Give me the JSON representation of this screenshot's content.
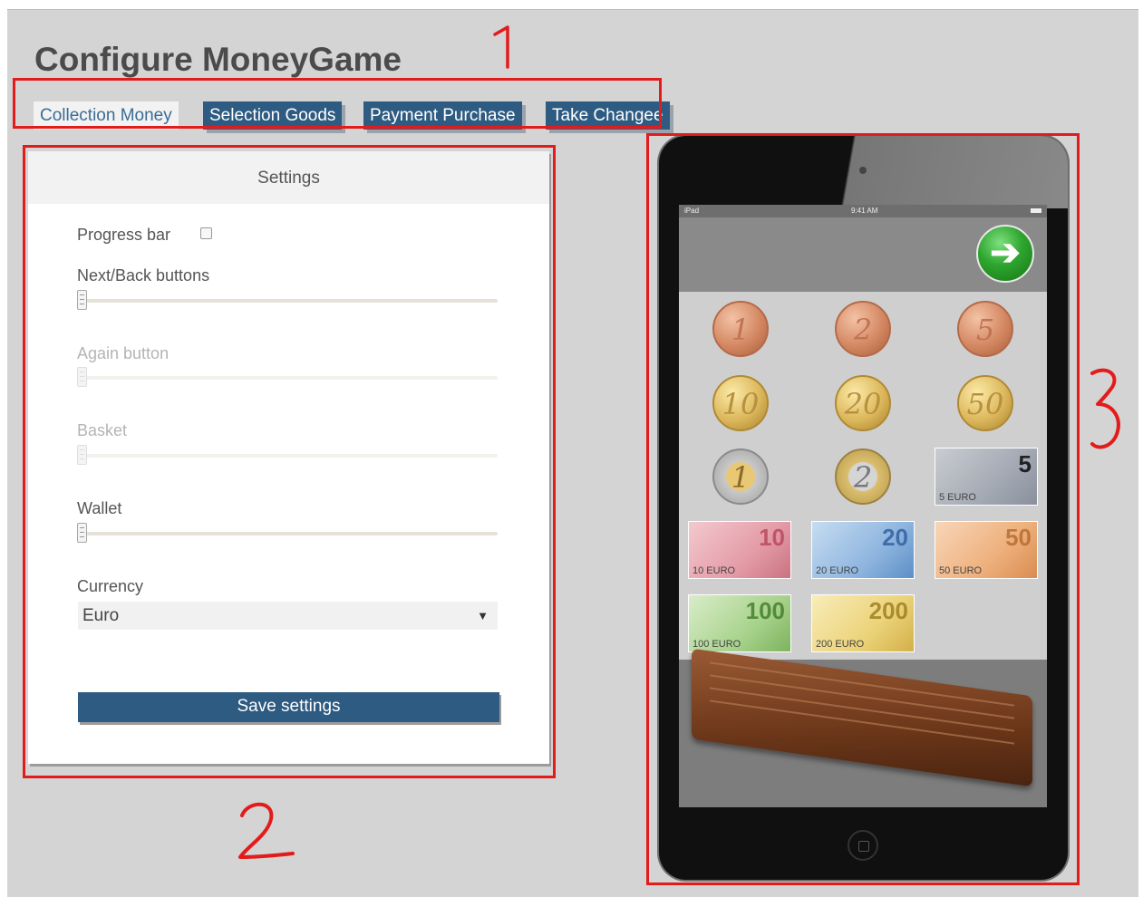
{
  "page": {
    "title": "Configure MoneyGame"
  },
  "tabs": [
    {
      "label": "Collection Money",
      "active": true
    },
    {
      "label": "Selection Goods",
      "active": false
    },
    {
      "label": "Payment Purchase",
      "active": false
    },
    {
      "label": "Take Changee",
      "active": false
    }
  ],
  "settings": {
    "header": "Settings",
    "progress_bar_label": "Progress bar",
    "progress_bar_checked": false,
    "next_back_label": "Next/Back buttons",
    "again_label": "Again button",
    "basket_label": "Basket",
    "wallet_label": "Wallet",
    "currency_label": "Currency",
    "currency_value": "Euro",
    "save_label": "Save settings"
  },
  "preview": {
    "status_device": "iPad",
    "status_time": "9:41 AM",
    "go_icon": "arrow-right-icon",
    "coins": [
      {
        "label": "1",
        "kind": "copper"
      },
      {
        "label": "2",
        "kind": "copper"
      },
      {
        "label": "5",
        "kind": "copper"
      },
      {
        "label": "10",
        "kind": "gold"
      },
      {
        "label": "20",
        "kind": "gold"
      },
      {
        "label": "50",
        "kind": "gold"
      },
      {
        "label": "1",
        "kind": "bi1"
      },
      {
        "label": "2",
        "kind": "bi2"
      }
    ],
    "notes": [
      {
        "value": "5",
        "small": "5 EURO"
      },
      {
        "value": "10",
        "small": "10 EURO"
      },
      {
        "value": "20",
        "small": "20 EURO"
      },
      {
        "value": "50",
        "small": "50 EURO"
      },
      {
        "value": "100",
        "small": "100 EURO"
      },
      {
        "value": "200",
        "small": "200 EURO"
      }
    ]
  },
  "annotations": {
    "one": "1",
    "two": "2",
    "three": "3",
    "color": "#e31b1b"
  },
  "colors": {
    "primary": "#2e5b81",
    "background": "#d4d4d4",
    "accent_red": "#e31b1b"
  }
}
